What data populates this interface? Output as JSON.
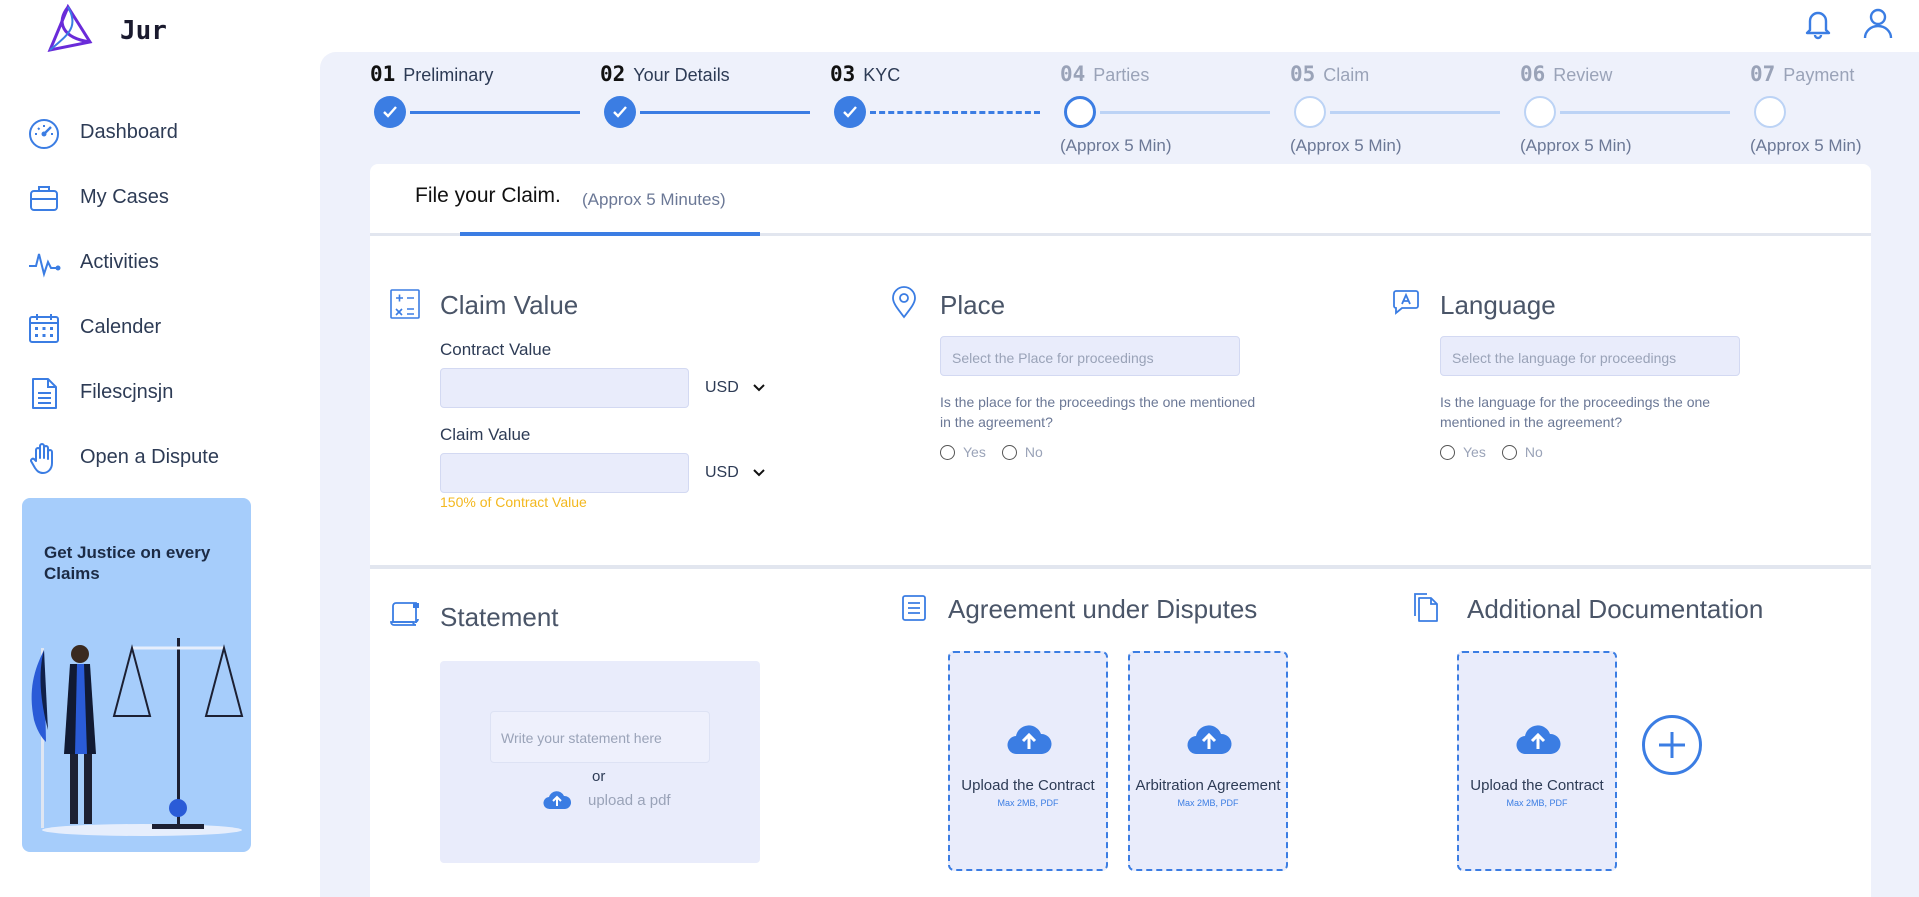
{
  "app": {
    "name": "Jur"
  },
  "sidebar": {
    "items": [
      {
        "label": "Dashboard",
        "icon": "dashboard-gauge-icon"
      },
      {
        "label": "My Cases",
        "icon": "briefcase-icon"
      },
      {
        "label": "Activities",
        "icon": "activity-pulse-icon"
      },
      {
        "label": "Calender",
        "icon": "calendar-icon"
      },
      {
        "label": "Filescjnsjn",
        "icon": "file-icon"
      },
      {
        "label": "Open a Dispute",
        "icon": "hand-icon"
      }
    ],
    "promo": {
      "text": "Get Justice on every Claims"
    }
  },
  "stepper": {
    "steps": [
      {
        "num": "01",
        "label": "Preliminary",
        "state": "done",
        "sub": ""
      },
      {
        "num": "02",
        "label": "Your Details",
        "state": "done",
        "sub": ""
      },
      {
        "num": "03",
        "label": "KYC",
        "state": "done",
        "sub": ""
      },
      {
        "num": "04",
        "label": "Parties",
        "state": "current",
        "sub": "(Approx 5 Min)"
      },
      {
        "num": "05",
        "label": "Claim",
        "state": "todo",
        "sub": "(Approx 5 Min)"
      },
      {
        "num": "06",
        "label": "Review",
        "state": "todo",
        "sub": "(Approx 5 Min)"
      },
      {
        "num": "07",
        "label": "Payment",
        "state": "todo",
        "sub": "(Approx 5 Min)"
      }
    ]
  },
  "card": {
    "title": "File your Claim.",
    "subtitle": "(Approx 5 Minutes)"
  },
  "claim_value": {
    "title": "Claim Value",
    "contract_label": "Contract Value",
    "contract_value": "",
    "contract_currency": "USD",
    "claim_label": "Claim Value",
    "claim_value": "",
    "claim_currency": "USD",
    "hint": "150% of Contract Value"
  },
  "place": {
    "title": "Place",
    "placeholder": "Select the Place for proceedings",
    "question": "Is the place for the proceedings the one mentioned in the agreement?",
    "yes": "Yes",
    "no": "No"
  },
  "language": {
    "title": "Language",
    "placeholder": "Select the language for proceedings",
    "question": "Is the language for the proceedings the one mentioned in the agreement?",
    "yes": "Yes",
    "no": "No"
  },
  "statement": {
    "title": "Statement",
    "placeholder": "Write your statement here",
    "or": "or",
    "upload_pdf": "upload a pdf"
  },
  "agreement": {
    "title": "Agreement under Disputes",
    "tiles": [
      {
        "label": "Upload the Contract",
        "sub": "Max 2MB, PDF"
      },
      {
        "label": "Arbitration Agreement",
        "sub": "Max 2MB, PDF"
      }
    ]
  },
  "additional": {
    "title": "Additional Documentation",
    "tiles": [
      {
        "label": "Upload the Contract",
        "sub": "Max 2MB, PDF"
      }
    ]
  },
  "colors": {
    "accent": "#3b7de3",
    "panel": "#eef1fb",
    "field": "#e9ecfb",
    "warning": "#f3b81f",
    "promo": "#a6cdfb"
  }
}
